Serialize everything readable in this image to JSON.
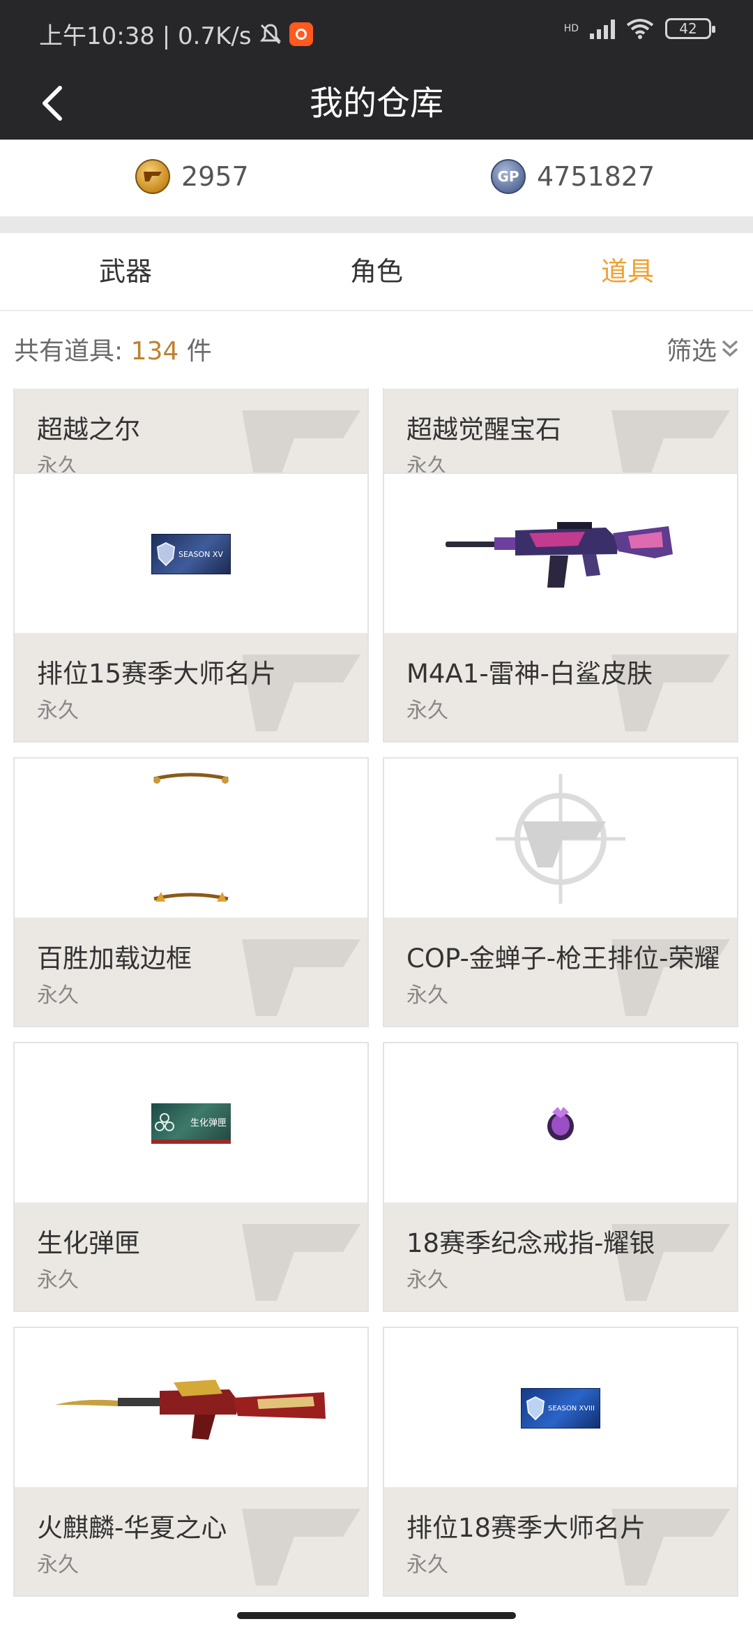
{
  "status_bar": {
    "time_speed": "上午10:38 | 0.7K/s",
    "network": "HD",
    "battery": "42"
  },
  "header": {
    "title": "我的仓库"
  },
  "currency": {
    "cf_points": "2957",
    "gp_points": "4751827",
    "gp_badge": "GP"
  },
  "tabs": [
    {
      "label": "武器",
      "active": false
    },
    {
      "label": "角色",
      "active": false
    },
    {
      "label": "道具",
      "active": true
    }
  ],
  "summary": {
    "prefix": "共有道具: ",
    "count": "134",
    "suffix": " 件",
    "filter_label": "筛选"
  },
  "items": [
    {
      "name": "超越之尔",
      "duration": "永久",
      "image": "none"
    },
    {
      "name": "超越觉醒宝石",
      "duration": "永久",
      "image": "none"
    },
    {
      "name": "排位15赛季大师名片",
      "duration": "永久",
      "image": "season-card",
      "image_text": "SEASON XV"
    },
    {
      "name": "M4A1-雷神-白鲨皮肤",
      "duration": "永久",
      "image": "rifle-m4"
    },
    {
      "name": "百胜加载边框",
      "duration": "永久",
      "image": "frame"
    },
    {
      "name": "COP-金蝉子-枪王排位-荣耀",
      "duration": "永久",
      "image": "cf-logo"
    },
    {
      "name": "生化弹匣",
      "duration": "永久",
      "image": "ammo-box",
      "image_text": "生化弹匣"
    },
    {
      "name": "18赛季纪念戒指-耀银",
      "duration": "永久",
      "image": "ring"
    },
    {
      "name": "火麒麟-华夏之心",
      "duration": "永久",
      "image": "rifle-ak"
    },
    {
      "name": "排位18赛季大师名片",
      "duration": "永久",
      "image": "season-card",
      "image_text": "SEASON XVIII"
    }
  ],
  "colors": {
    "header_bg": "#27272a",
    "accent": "#f0a030",
    "count_num": "#c08030",
    "card_info_bg": "#ebe8e4"
  }
}
